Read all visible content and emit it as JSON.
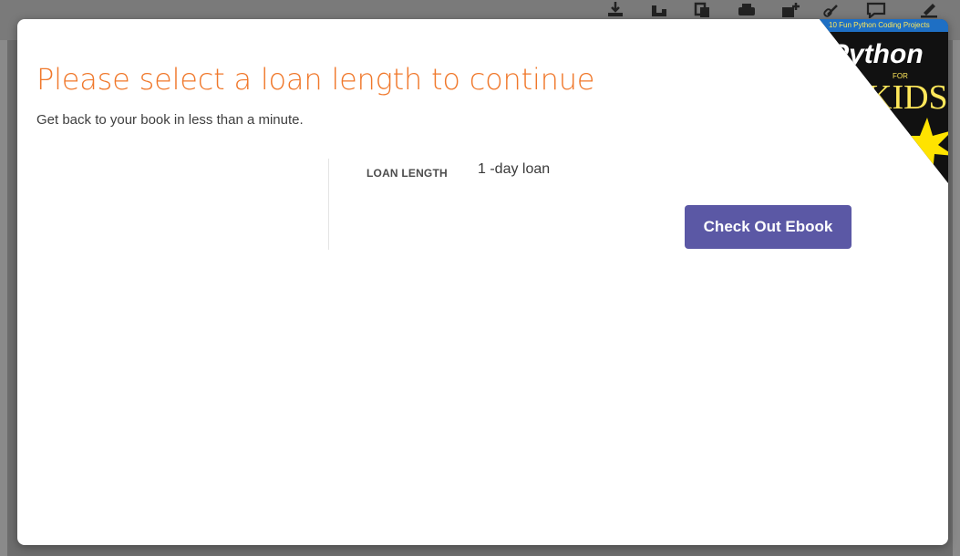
{
  "background_toolbar": {
    "icons": [
      "download-icon",
      "import-icon",
      "copy-icon",
      "print-icon",
      "add-note-icon",
      "link-icon",
      "comment-icon",
      "highlight-icon"
    ]
  },
  "modal": {
    "title": "Please select a loan length to continue",
    "subtitle": "Get back to your book in less than a minute.",
    "loan": {
      "label": "LOAN LENGTH",
      "value": "1 -day loan"
    },
    "checkout_button": "Check Out Ebook",
    "book_cover": {
      "band_text": "10 Fun Python Coding Projects",
      "title_word": "Python",
      "for_word": "FOR",
      "kids_word": "KIDS"
    }
  },
  "colors": {
    "title_orange": "#f0782b",
    "button_purple": "#5b58a5",
    "overlay_gray": "#6d6d6d"
  }
}
